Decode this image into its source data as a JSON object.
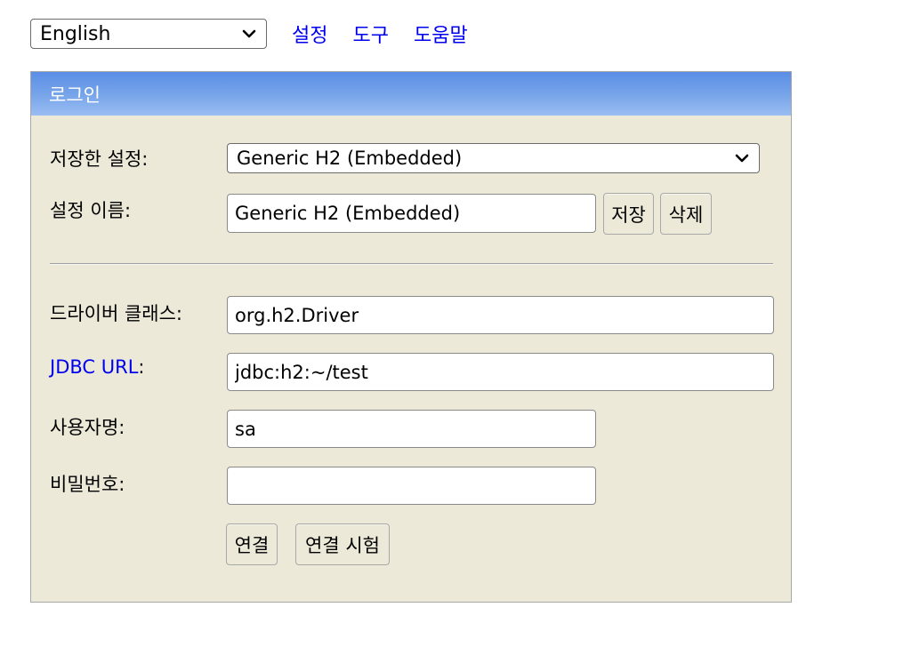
{
  "topbar": {
    "language_selected": "English",
    "links": [
      "설정",
      "도구",
      "도움말"
    ]
  },
  "login": {
    "header": "로그인",
    "saved_settings_label": "저장한 설정:",
    "saved_settings_value": "Generic H2 (Embedded)",
    "setting_name_label": "설정 이름:",
    "setting_name_value": "Generic H2 (Embedded)",
    "save_button": "저장",
    "delete_button": "삭제",
    "driver_class_label": "드라이버 클래스:",
    "driver_class_value": "org.h2.Driver",
    "jdbc_url_label": "JDBC URL",
    "jdbc_url_colon": ":",
    "jdbc_url_value": "jdbc:h2:~/test",
    "username_label": "사용자명:",
    "username_value": "sa",
    "password_label": "비밀번호:",
    "password_value": "",
    "connect_button": "연결",
    "test_connection_button": "연결 시험"
  },
  "icons": {
    "dropdown": "chevron-down-icon"
  },
  "colors": {
    "header_gradient_top": "#5a8ee6",
    "header_gradient_bottom": "#9abdf2",
    "panel_background": "#ece9d8",
    "link": "#0000ee"
  }
}
